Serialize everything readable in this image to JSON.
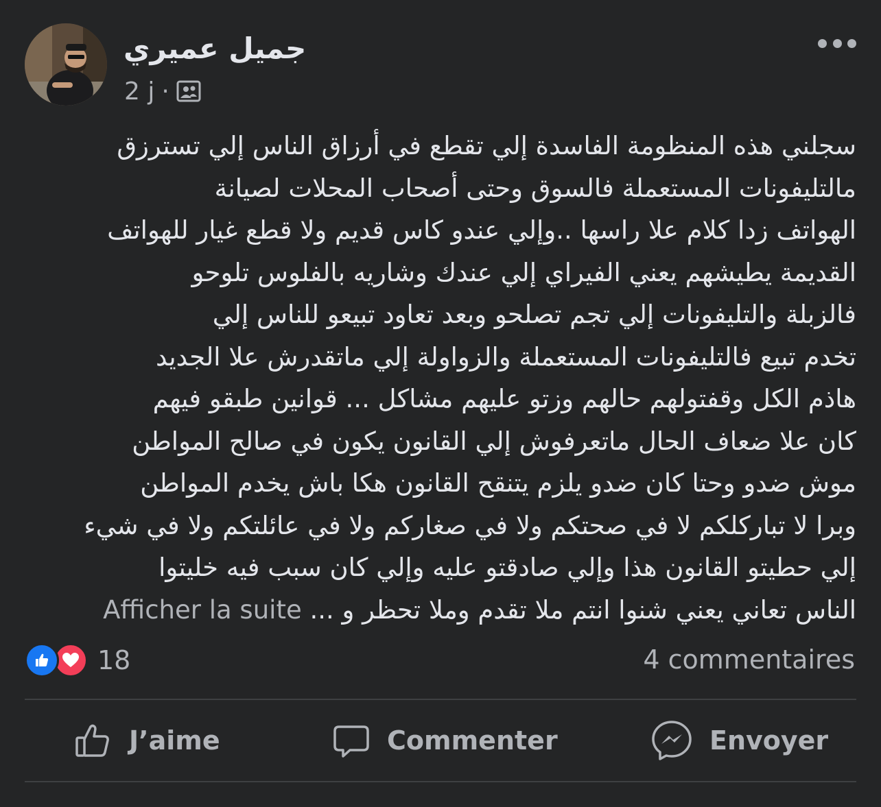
{
  "post": {
    "author_name": "جميل عميري",
    "time": "2 j",
    "separator": "·",
    "audience_icon": "friends-audience-icon",
    "text_lines": [
      "سجلني هذه المنظومة الفاسدة إلي تقطع في أرزاق الناس إلي تسترزق",
      "مالتليفونات المستعملة فالسوق وحتى أصحاب المحلات لصيانة",
      "الهواتف زدا كلام علا راسها ..وإلي عندو كاس قديم ولا قطع غيار للهواتف",
      "القديمة يطيشهم يعني الفيراي  إلي عندك وشاريه بالفلوس تلوحو",
      "فالزبلة  والتليفونات إلي تجم تصلحو  وبعد تعاود  تبيعو للناس إلي",
      "تخدم تبيع فالتليفونات المستعملة والزواولة  إلي ماتقدرش  علا الجديد",
      "هاذم الكل وقفتولهم حالهم وزتو عليهم مشاكل ... قوانين طبقو فيهم",
      "كان علا ضعاف الحال ماتعرفوش إلي القانون يكون في صالح المواطن",
      "موش ضدو وحتا كان ضدو يلزم يتنقح القانون هكا باش يخدم المواطن",
      "وبرا لا تباركلكم لا في صحتكم ولا في صغاركم ولا في عائلتكم ولا في شيء",
      "إلي حطيتو القانون هذا وإلي صادقتو عليه وإلي كان سبب فيه خليتوا"
    ],
    "last_line_text": "الناس تعاني يعني شنوا انتم ملا تقدم وملا تحظر و ...",
    "see_more_label": "Afficher la suite"
  },
  "reactions": {
    "count": "18",
    "types": [
      "like-reaction-icon",
      "love-reaction-icon"
    ],
    "comments_label": "4 commentaires"
  },
  "actions": {
    "like_label": "J’aime",
    "comment_label": "Commenter",
    "send_label": "Envoyer"
  },
  "colors": {
    "background": "#242526",
    "text_primary": "#e4e6eb",
    "text_secondary": "#b0b3b8",
    "like_blue": "#1877f2",
    "love_red": "#f33e58",
    "divider": "#3e4042"
  }
}
